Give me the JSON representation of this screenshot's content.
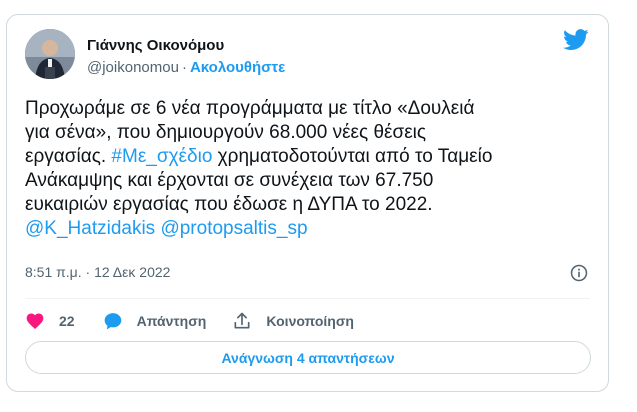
{
  "author": {
    "name": "Γιάννης Οικονόμου",
    "handle": "@joikonomou",
    "separator": "·",
    "follow_label": "Ακολουθήστε"
  },
  "tweet": {
    "text_before_hashtag": "Προχωράμε σε 6 νέα προγράμματα με τίτλο «Δουλειά\nγια σένα», που  δημιουργούν 68.000 νέες θέσεις\nεργασίας. ",
    "hashtag": "#Με_σχέδιο",
    "text_after_hashtag": " χρηματοδοτούνται από το Ταμείο\nΑνάκαμψης και έρχονται σε συνέχεια των 67.750\nευκαιριών εργασίας που έδωσε η ΔΥΠΑ το 2022.\n",
    "mention_1": "@K_Hatzidakis",
    "mention_2": "@protopsaltis_sp"
  },
  "meta": {
    "time": "8:51 π.μ.",
    "separator": "·",
    "date": "12 Δεκ 2022"
  },
  "actions": {
    "likes_count": "22",
    "reply_label": "Απάντηση",
    "share_label": "Κοινοποίηση"
  },
  "read_replies_label": "Ανάγνωση 4 απαντήσεων",
  "colors": {
    "accent": "#1d9bf0",
    "like": "#f91880",
    "secondary_text": "#536471",
    "border": "#cfd9de"
  },
  "icons": [
    "twitter-bird-icon",
    "info-icon",
    "heart-icon",
    "reply-bubble-icon",
    "share-upload-icon"
  ]
}
